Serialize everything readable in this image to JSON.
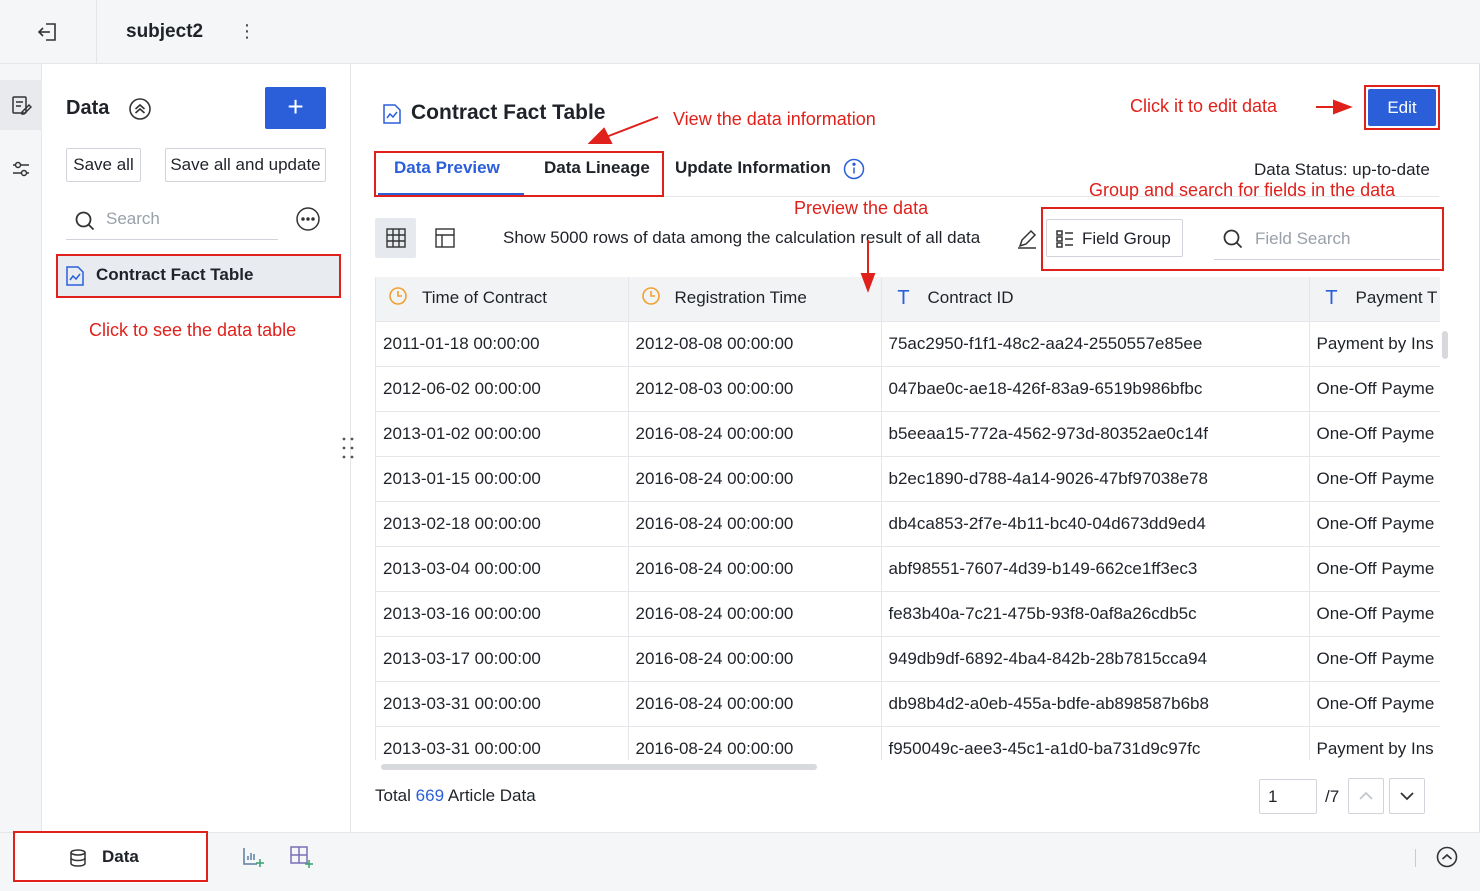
{
  "app": {
    "title": "subject2",
    "more_icon": "more-vertical-icon"
  },
  "left_panel": {
    "title": "Data",
    "save_all": "Save all",
    "save_all_update": "Save all and update",
    "search_placeholder": "Search",
    "tables": [
      {
        "label": "Contract Fact Table",
        "icon": "chart-table-icon",
        "selected": true
      }
    ]
  },
  "main": {
    "title": "Contract Fact Table",
    "edit_label": "Edit",
    "tabs": [
      {
        "label": "Data Preview",
        "active": true
      },
      {
        "label": "Data Lineage",
        "active": false
      },
      {
        "label": "Update Information",
        "active": false
      }
    ],
    "data_status": "Data Status: up-to-date",
    "toolbar_text": "Show 5000 rows of data among the calculation result of all data",
    "field_group_label": "Field Group",
    "field_search_placeholder": "Field Search",
    "columns": [
      {
        "label": "Time of Contract",
        "type": "datetime"
      },
      {
        "label": "Registration Time",
        "type": "datetime"
      },
      {
        "label": "Contract ID",
        "type": "text"
      },
      {
        "label": "Payment T",
        "type": "text"
      }
    ],
    "rows": [
      [
        "2011-01-18 00:00:00",
        "2012-08-08 00:00:00",
        "75ac2950-f1f1-48c2-aa24-2550557e85ee",
        "Payment by Ins"
      ],
      [
        "2012-06-02 00:00:00",
        "2012-08-03 00:00:00",
        "047bae0c-ae18-426f-83a9-6519b986bfbc",
        "One-Off Payme"
      ],
      [
        "2013-01-02 00:00:00",
        "2016-08-24 00:00:00",
        "b5eeaa15-772a-4562-973d-80352ae0c14f",
        "One-Off Payme"
      ],
      [
        "2013-01-15 00:00:00",
        "2016-08-24 00:00:00",
        "b2ec1890-d788-4a14-9026-47bf97038e78",
        "One-Off Payme"
      ],
      [
        "2013-02-18 00:00:00",
        "2016-08-24 00:00:00",
        "db4ca853-2f7e-4b11-bc40-04d673dd9ed4",
        "One-Off Payme"
      ],
      [
        "2013-03-04 00:00:00",
        "2016-08-24 00:00:00",
        "abf98551-7607-4d39-b149-662ce1ff3ec3",
        "One-Off Payme"
      ],
      [
        "2013-03-16 00:00:00",
        "2016-08-24 00:00:00",
        "fe83b40a-7c21-475b-93f8-0af8a26cdb5c",
        "One-Off Payme"
      ],
      [
        "2013-03-17 00:00:00",
        "2016-08-24 00:00:00",
        "949db9df-6892-4ba4-842b-28b7815cca94",
        "One-Off Payme"
      ],
      [
        "2013-03-31 00:00:00",
        "2016-08-24 00:00:00",
        "db98b4d2-a0eb-455a-bdfe-ab898587b6b8",
        "One-Off Payme"
      ],
      [
        "2013-03-31 00:00:00",
        "2016-08-24 00:00:00",
        "f950049c-aee3-45c1-a1d0-ba731d9c97fc",
        "Payment by Ins"
      ]
    ],
    "total_prefix": "Total",
    "total_count": "669",
    "total_suffix": "Article Data",
    "page_current": "1",
    "page_total": "/7"
  },
  "bottom_bar": {
    "data_label": "Data"
  },
  "annotations": {
    "view_info": "View the data information",
    "click_edit": "Click it to edit data",
    "group_search": "Group and search for fields in the data",
    "preview": "Preview the data",
    "click_table": "Click to see the data table"
  },
  "colors": {
    "accent": "#2b5fd9",
    "annotation": "#e0201b",
    "datetime_icon": "#f0a030"
  }
}
